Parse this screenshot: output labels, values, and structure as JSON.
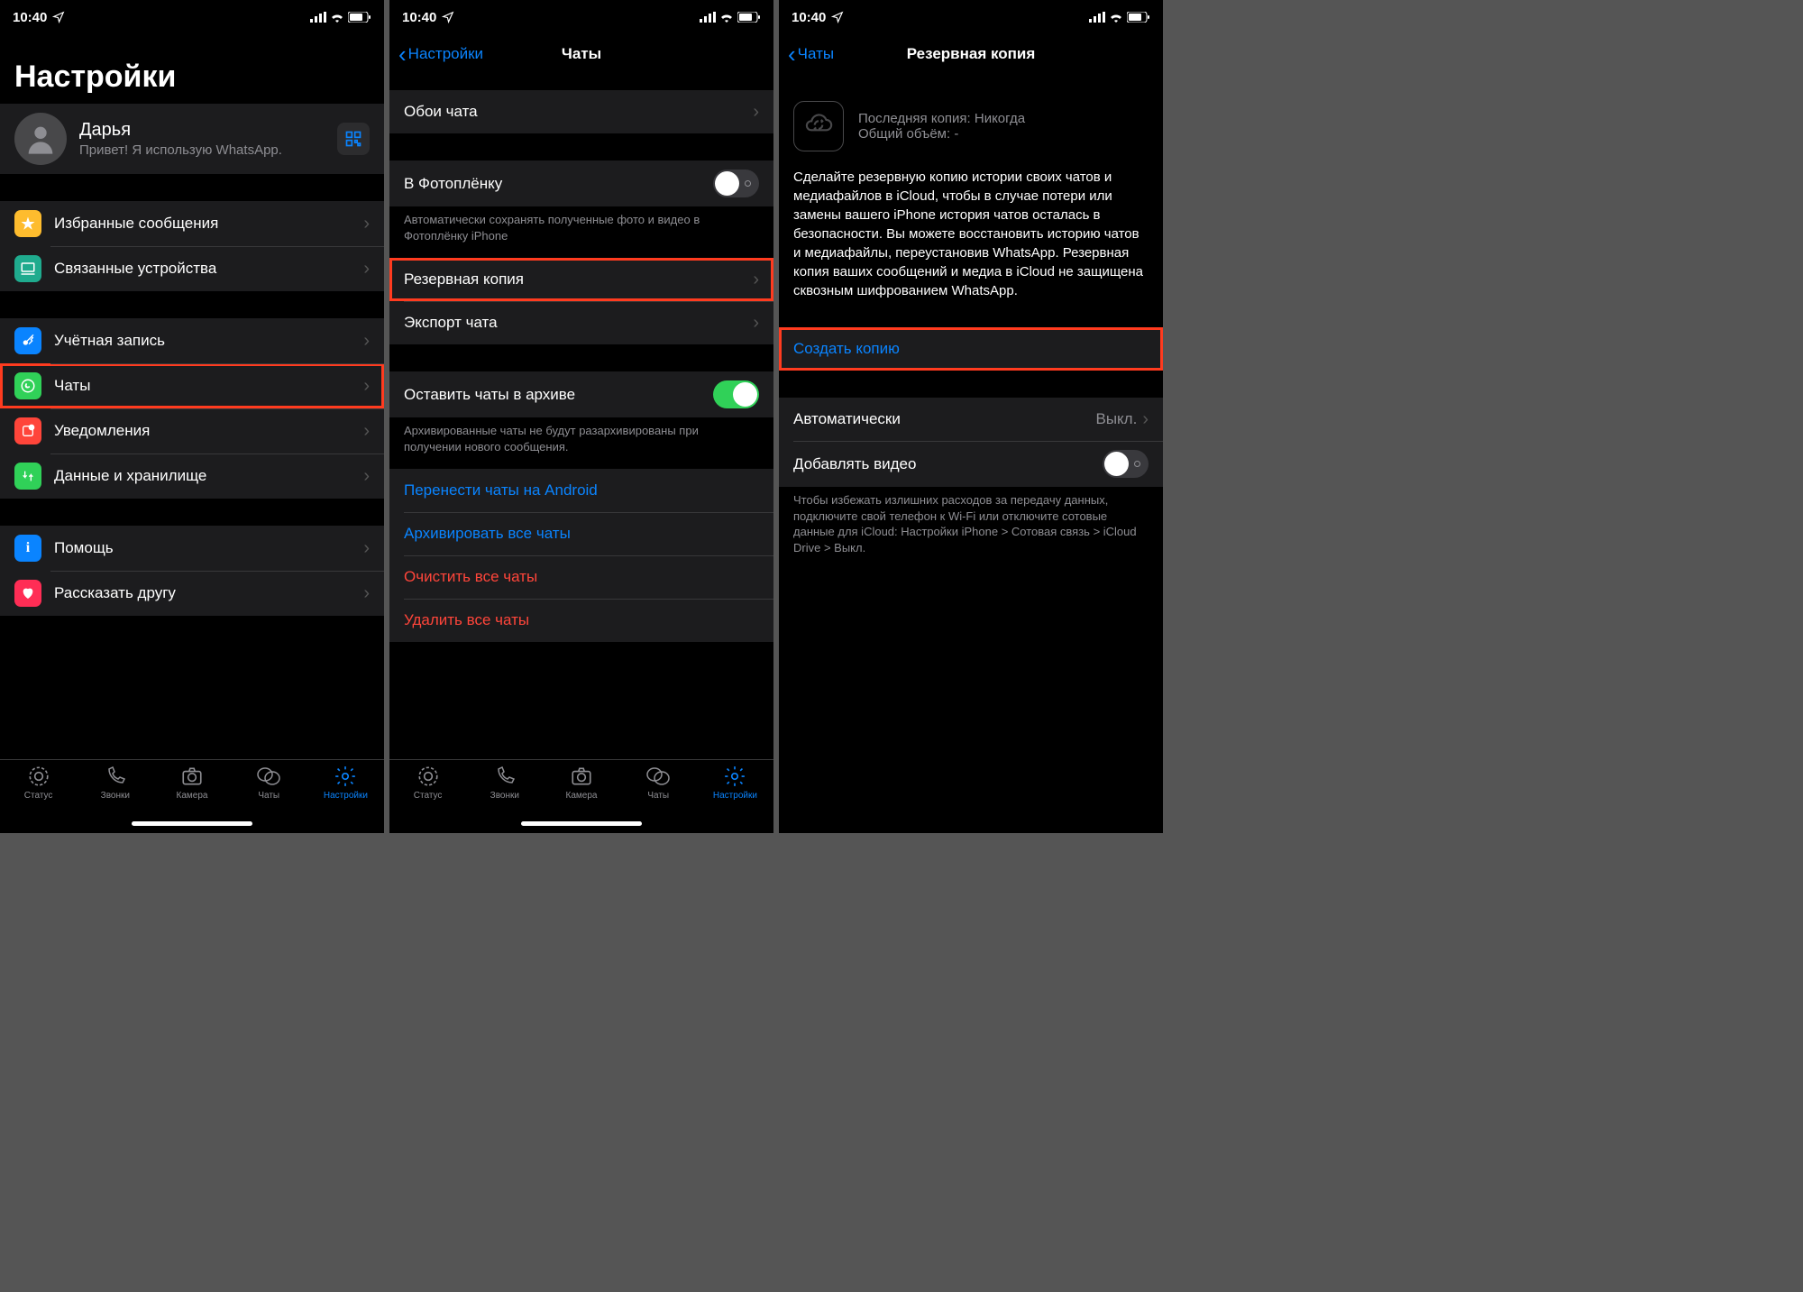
{
  "status": {
    "time": "10:40"
  },
  "tabs": {
    "status": "Статус",
    "calls": "Звонки",
    "camera": "Камера",
    "chats": "Чаты",
    "settings": "Настройки"
  },
  "screen1": {
    "title": "Настройки",
    "profile": {
      "name": "Дарья",
      "status": "Привет! Я использую WhatsApp."
    },
    "rows": {
      "starred": "Избранные сообщения",
      "linked": "Связанные устройства",
      "account": "Учётная запись",
      "chats": "Чаты",
      "notifications": "Уведомления",
      "storage": "Данные и хранилище",
      "help": "Помощь",
      "tell": "Рассказать другу"
    }
  },
  "screen2": {
    "back": "Настройки",
    "title": "Чаты",
    "rows": {
      "wallpaper": "Обои чата",
      "saveMedia": "В Фотоплёнку",
      "saveMediaFooter": "Автоматически сохранять полученные фото и видео в Фотоплёнку iPhone",
      "backup": "Резервная копия",
      "export": "Экспорт чата",
      "keepArchived": "Оставить чаты в архиве",
      "keepArchivedFooter": "Архивированные чаты не будут разархивированы при получении нового сообщения.",
      "moveAndroid": "Перенести чаты на Android",
      "archiveAll": "Архивировать все чаты",
      "clearAll": "Очистить все чаты",
      "deleteAll": "Удалить все чаты"
    }
  },
  "screen3": {
    "back": "Чаты",
    "title": "Резервная копия",
    "info": {
      "lastBackup": "Последняя копия: Никогда",
      "totalSize": "Общий объём: -"
    },
    "desc": "Сделайте резервную копию истории своих чатов и медиафайлов в iCloud, чтобы в случае потери или замены вашего iPhone история чатов осталась в безопасности. Вы можете восстановить историю чатов и медиафайлы, переустановив WhatsApp. Резервная копия ваших сообщений и медиа в iCloud не защищена сквозным шифрованием WhatsApp.",
    "rows": {
      "create": "Создать копию",
      "auto": "Автоматически",
      "autoValue": "Выкл.",
      "includeVideo": "Добавлять видео",
      "videoFooter": "Чтобы избежать излишних расходов за передачу данных, подключите свой телефон к Wi-Fi или отключите сотовые данные для iCloud: Настройки iPhone > Сотовая связь > iCloud Drive > Выкл."
    }
  }
}
